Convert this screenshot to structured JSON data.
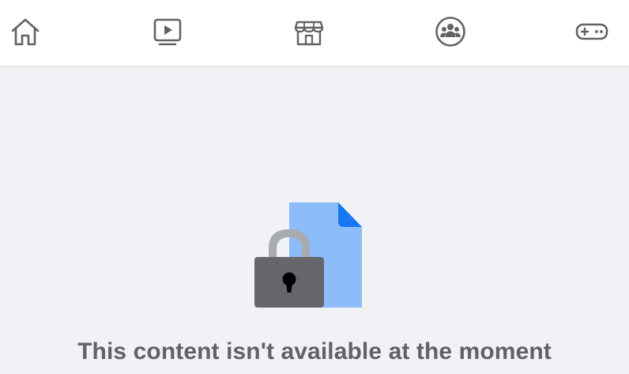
{
  "nav": {
    "items": [
      {
        "name": "home",
        "icon": "home-icon"
      },
      {
        "name": "watch",
        "icon": "video-play-icon"
      },
      {
        "name": "marketplace",
        "icon": "storefront-icon"
      },
      {
        "name": "groups",
        "icon": "groups-icon"
      },
      {
        "name": "gaming",
        "icon": "gamepad-icon"
      }
    ],
    "icon_color": "#606266"
  },
  "main": {
    "illustration": "locked-document-icon",
    "message": "This content isn't available at the moment"
  },
  "colors": {
    "background": "#f0f2f5",
    "topbar": "#ffffff",
    "document": "#8cbcfa",
    "document_fold": "#1877f2",
    "lock_body": "#65676b",
    "lock_shackle": "#a8abaf"
  }
}
